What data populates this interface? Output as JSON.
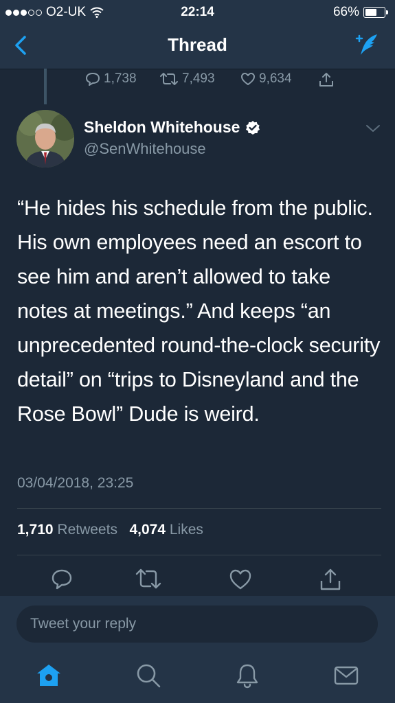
{
  "status_bar": {
    "carrier": "O2-UK",
    "time": "22:14",
    "battery": "66%",
    "battery_level": 0.66
  },
  "nav": {
    "title": "Thread"
  },
  "previous_tweet": {
    "replies": "1,738",
    "retweets": "7,493",
    "likes": "9,634"
  },
  "tweet": {
    "author_name": "Sheldon Whitehouse",
    "author_handle": "@SenWhitehouse",
    "text": "“He hides his schedule from the public. His own employees need an escort to see him and aren’t allowed to take notes at meetings.” And keeps “an unprecedented round-the-clock security detail” on “trips to Disneyland and the Rose Bowl” Dude is weird.",
    "timestamp": "03/04/2018, 23:25",
    "retweets_count": "1,710",
    "retweets_label": "Retweets",
    "likes_count": "4,074",
    "likes_label": "Likes"
  },
  "reply": {
    "placeholder": "Tweet your reply"
  },
  "colors": {
    "background": "#1c2837",
    "bar": "#243447",
    "accent": "#1da1f2",
    "muted": "#8899a6"
  },
  "icons": [
    "back-chevron-icon",
    "compose-tweet-icon",
    "reply-icon",
    "retweet-icon",
    "like-icon",
    "share-icon",
    "verified-badge-icon",
    "chevron-down-icon",
    "home-icon",
    "search-icon",
    "notifications-icon",
    "messages-icon"
  ]
}
